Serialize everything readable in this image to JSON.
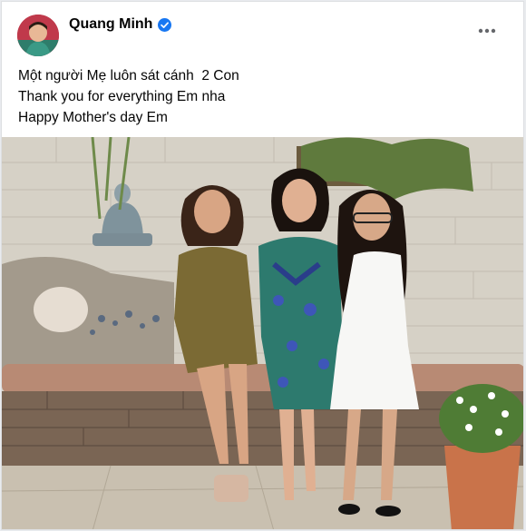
{
  "post": {
    "author": "Quang Minh",
    "verified": true,
    "lines": [
      "Một người Mẹ luôn sát cánh  2 Con",
      "Thank you for everything Em nha",
      "Happy Mother's day Em"
    ],
    "more_icon": "more-horizontal-icon",
    "verified_icon": "verified-badge-icon"
  },
  "colors": {
    "accent": "#1877f2",
    "text": "#050505",
    "border": "#dddfe2"
  }
}
